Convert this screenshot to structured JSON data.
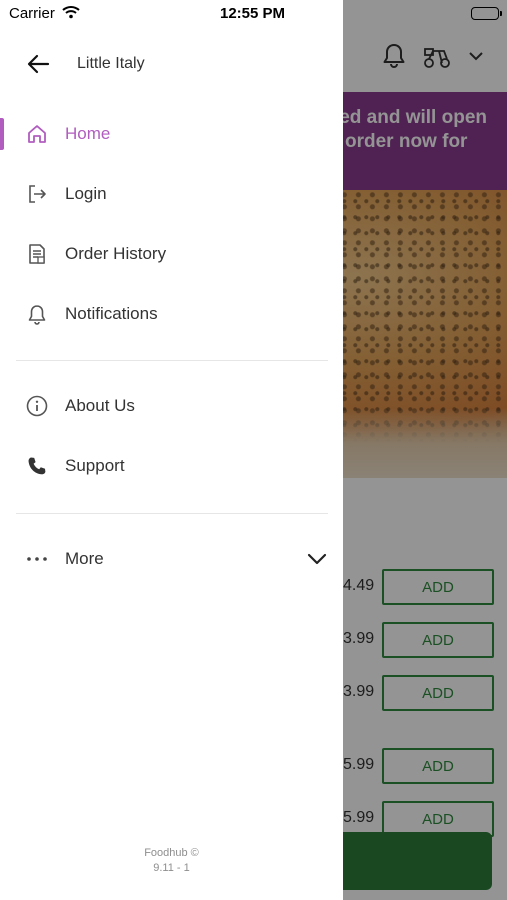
{
  "status_bar": {
    "carrier": "Carrier",
    "time": "12:55 PM"
  },
  "drawer": {
    "restaurant_name": "Little Italy",
    "back_icon": "arrow-left-icon",
    "accent_color": "#b05dbf",
    "items": [
      {
        "label": "Home",
        "icon": "home-icon",
        "active": true
      },
      {
        "label": "Login",
        "icon": "login-icon",
        "active": false
      },
      {
        "label": "Order History",
        "icon": "receipt-icon",
        "active": false
      },
      {
        "label": "Notifications",
        "icon": "bell-icon",
        "active": false
      }
    ],
    "secondary_items": [
      {
        "label": "About Us",
        "icon": "info-icon"
      },
      {
        "label": "Support",
        "icon": "phone-icon"
      }
    ],
    "more": {
      "label": "More",
      "icon": "ellipsis-icon",
      "chevron": "chevron-down-icon"
    },
    "footer": {
      "copyright": "Foodhub ©",
      "version": "9.11 - 1"
    }
  },
  "background": {
    "banner_line1": "ed and will open",
    "banner_line2": "order now for",
    "banner_color": "#8b3b8f",
    "items": [
      {
        "price": "4.49",
        "add_label": "ADD"
      },
      {
        "price": "3.99",
        "add_label": "ADD"
      },
      {
        "price": "3.99",
        "add_label": "ADD"
      },
      {
        "price": "5.99",
        "add_label": "ADD"
      },
      {
        "price": "5.99",
        "add_label": "ADD"
      }
    ],
    "accent_green": "#2f8a3e"
  }
}
